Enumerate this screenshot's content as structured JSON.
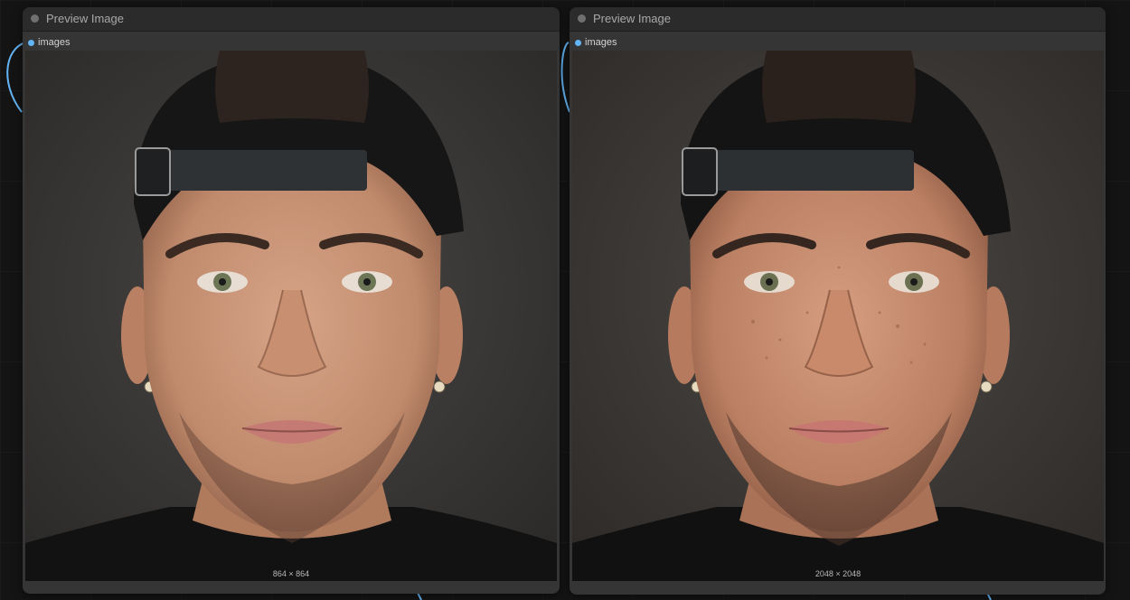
{
  "nodes": [
    {
      "title": "Preview Image",
      "input_label": "images",
      "image_size": "864 × 864",
      "image_description": "Front-facing portrait of a young man wearing a backwards black cap with strap, stubble beard, stud earrings, black t-shirt, dark gray background"
    },
    {
      "title": "Preview Image",
      "input_label": "images",
      "image_size": "2048 × 2048",
      "image_description": "Higher-resolution front-facing portrait of a man wearing a backwards black cap with strap, detailed skin texture and freckles, stubble beard, stud earrings, black t-shirt, dark gray background"
    }
  ],
  "colors": {
    "canvas": "#141414",
    "node_body": "#353535",
    "node_header": "#2b2b2b",
    "slot": "#64b5f6",
    "wire": "#64b5f6"
  }
}
